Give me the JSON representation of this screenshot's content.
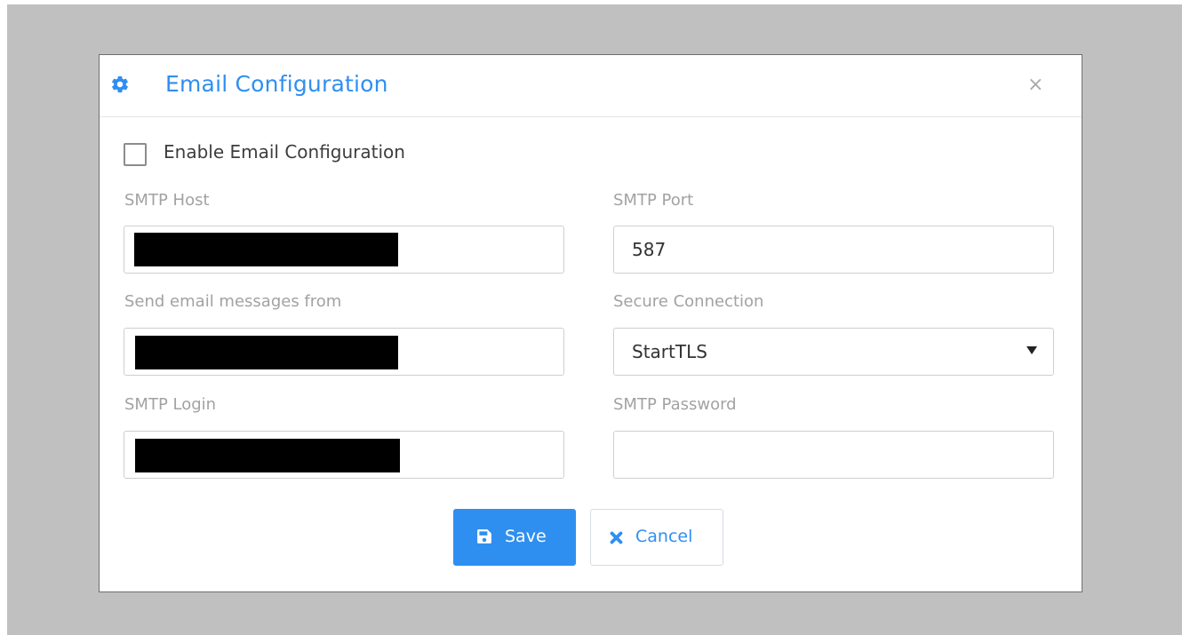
{
  "dialog": {
    "title": "Email Configuration",
    "title_icon": "gear-icon",
    "close_label": "×"
  },
  "enable": {
    "label": "Enable Email Configuration",
    "checked": false
  },
  "fields": {
    "smtp_host": {
      "label": "SMTP Host",
      "value": "[redacted]"
    },
    "smtp_port": {
      "label": "SMTP Port",
      "value": "587"
    },
    "from": {
      "label": "Send email messages from",
      "value": "[redacted]"
    },
    "secure_connection": {
      "label": "Secure Connection",
      "value": "StartTLS"
    },
    "smtp_login": {
      "label": "SMTP Login",
      "value": "[redacted]"
    },
    "smtp_password": {
      "label": "SMTP Password",
      "value": ""
    }
  },
  "buttons": {
    "save_label": "Save",
    "save_icon": "floppy-disk-icon",
    "cancel_label": "Cancel",
    "cancel_icon": "x-icon"
  },
  "colors": {
    "accent": "#2f8ff0",
    "backdrop": "#c0c0c0"
  }
}
